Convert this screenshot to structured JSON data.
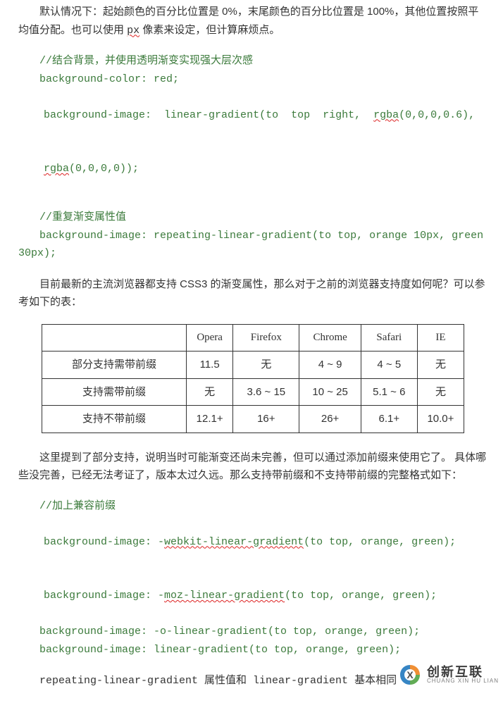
{
  "p1_a": "默认情况下：起始颜色的百分比位置是 0%，末尾颜色的百分比位置是 100%，其他位置按照平均值分配。也可以使用 ",
  "p1_px": "px",
  "p1_b": " 像素来设定，但计算麻烦点。",
  "code1": {
    "c1": "//结合背景，并使用透明渐变实现强大层次感",
    "l1": "background-color: red;",
    "l2a": "background-image:  linear-gradient(to  top  right,  ",
    "l2_rgba": "rgba",
    "l2b": "(0,0,0,0.6), ",
    "l2_rgba2": "rgba",
    "l2c": "(0,0,0,0));"
  },
  "code2": {
    "c1": "//重复渐变属性值",
    "l1a": "background-image: repeating-linear-gradient(to top, orange 10px, green 30px);"
  },
  "p2": "目前最新的主流浏览器都支持 CSS3 的渐变属性，那么对于之前的浏览器支持度如何呢？可以参考如下的表：",
  "table": {
    "headers": [
      "",
      "Opera",
      "Firefox",
      "Chrome",
      "Safari",
      "IE"
    ],
    "rows": [
      {
        "label": "部分支持需带前缀",
        "cells": [
          "11.5",
          "无",
          "4 ~ 9",
          "4 ~ 5",
          "无"
        ]
      },
      {
        "label": "支持需带前缀",
        "cells": [
          "无",
          "3.6 ~ 15",
          "10 ~ 25",
          "5.1 ~ 6",
          "无"
        ]
      },
      {
        "label": "支持不带前缀",
        "cells": [
          "12.1+",
          "16+",
          "26+",
          "6.1+",
          "10.0+"
        ]
      }
    ]
  },
  "p3": "这里提到了部分支持，说明当时可能渐变还尚未完善，但可以通过添加前缀来使用它了。   具体哪些没完善，已经无法考证了，版本太过久远。那么支持带前缀和不支持带前缀的完整格式如下：",
  "code3": {
    "c1": "//加上兼容前缀",
    "l1a": "background-image: -",
    "l1_fn": "webkit-linear-gradient",
    "l1b": "(to top, orange, green);",
    "l2a": "background-image: -",
    "l2_fn": "moz-linear-gradient",
    "l2b": "(to top, orange, green);",
    "l3": "background-image: -o-linear-gradient(to top, orange, green);",
    "l4": "background-image: linear-gradient(to top, orange, green);"
  },
  "p4": "repeating-linear-gradient 属性值和 linear-gradient 基本相同",
  "watermark": {
    "title": "创新互联",
    "sub": "CHUANG XIN HU LIAN"
  }
}
